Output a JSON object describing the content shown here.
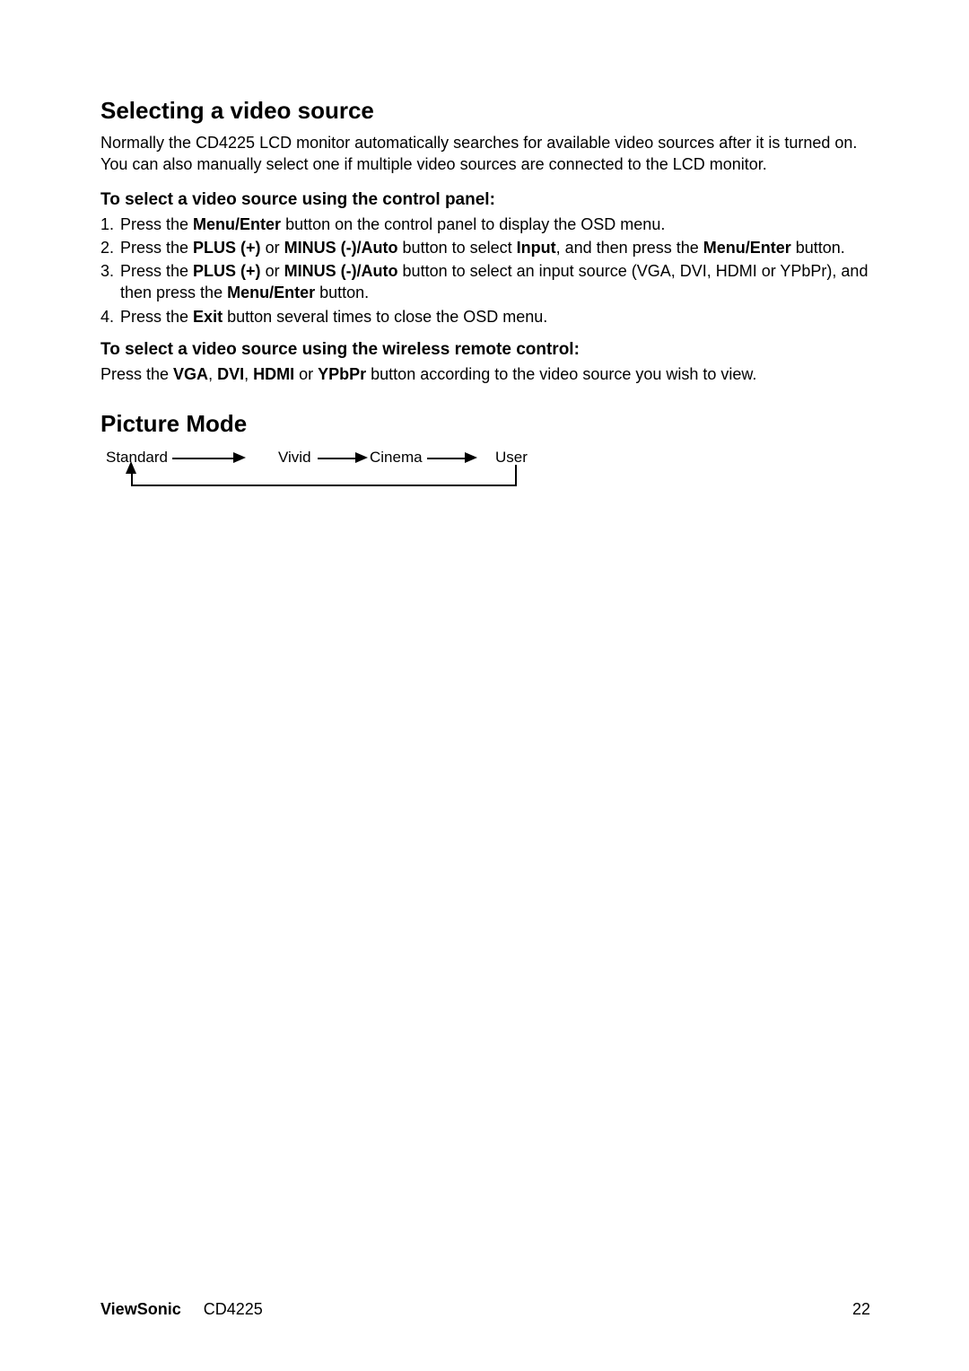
{
  "section1": {
    "heading": "Selecting a video source",
    "intro": "Normally the CD4225 LCD monitor automatically searches for available video sources after it is turned on. You can also manually select one if multiple video sources are connected to the LCD monitor.",
    "sub1": "To select a video source using the control panel:",
    "steps": {
      "s1_a": "Press the ",
      "s1_b": "Menu/Enter",
      "s1_c": " button on the control panel to display the OSD menu.",
      "s2_a": "Press the ",
      "s2_b": "PLUS (+)",
      "s2_c": " or ",
      "s2_d": "MINUS (-)/Auto",
      "s2_e": " button to select ",
      "s2_f": "Input",
      "s2_g": ", and then press the ",
      "s2_h": "Menu/Enter",
      "s2_i": " button.",
      "s3_a": "Press the ",
      "s3_b": "PLUS (+)",
      "s3_c": " or ",
      "s3_d": "MINUS (-)/Auto",
      "s3_e": " button to select an input source (VGA, DVI, HDMI or YPbPr), and then press the ",
      "s3_f": "Menu/Enter",
      "s3_g": " button.",
      "s4_a": "Press the ",
      "s4_b": "Exit",
      "s4_c": " button several times to close the OSD menu."
    },
    "sub2": "To select a video source using the wireless remote control:",
    "remote_a": "Press the ",
    "remote_b": "VGA",
    "remote_c": ", ",
    "remote_d": "DVI",
    "remote_e": ", ",
    "remote_f": "HDMI",
    "remote_g": " or ",
    "remote_h": "YPbPr",
    "remote_i": " button according to the video source you wish to view."
  },
  "picture": {
    "heading": "Picture Mode",
    "standard": "Standard",
    "vivid": "Vivid",
    "cinema": "Cinema",
    "user": "User"
  },
  "footer": {
    "brand": "ViewSonic",
    "model": "CD4225",
    "page": "22"
  }
}
